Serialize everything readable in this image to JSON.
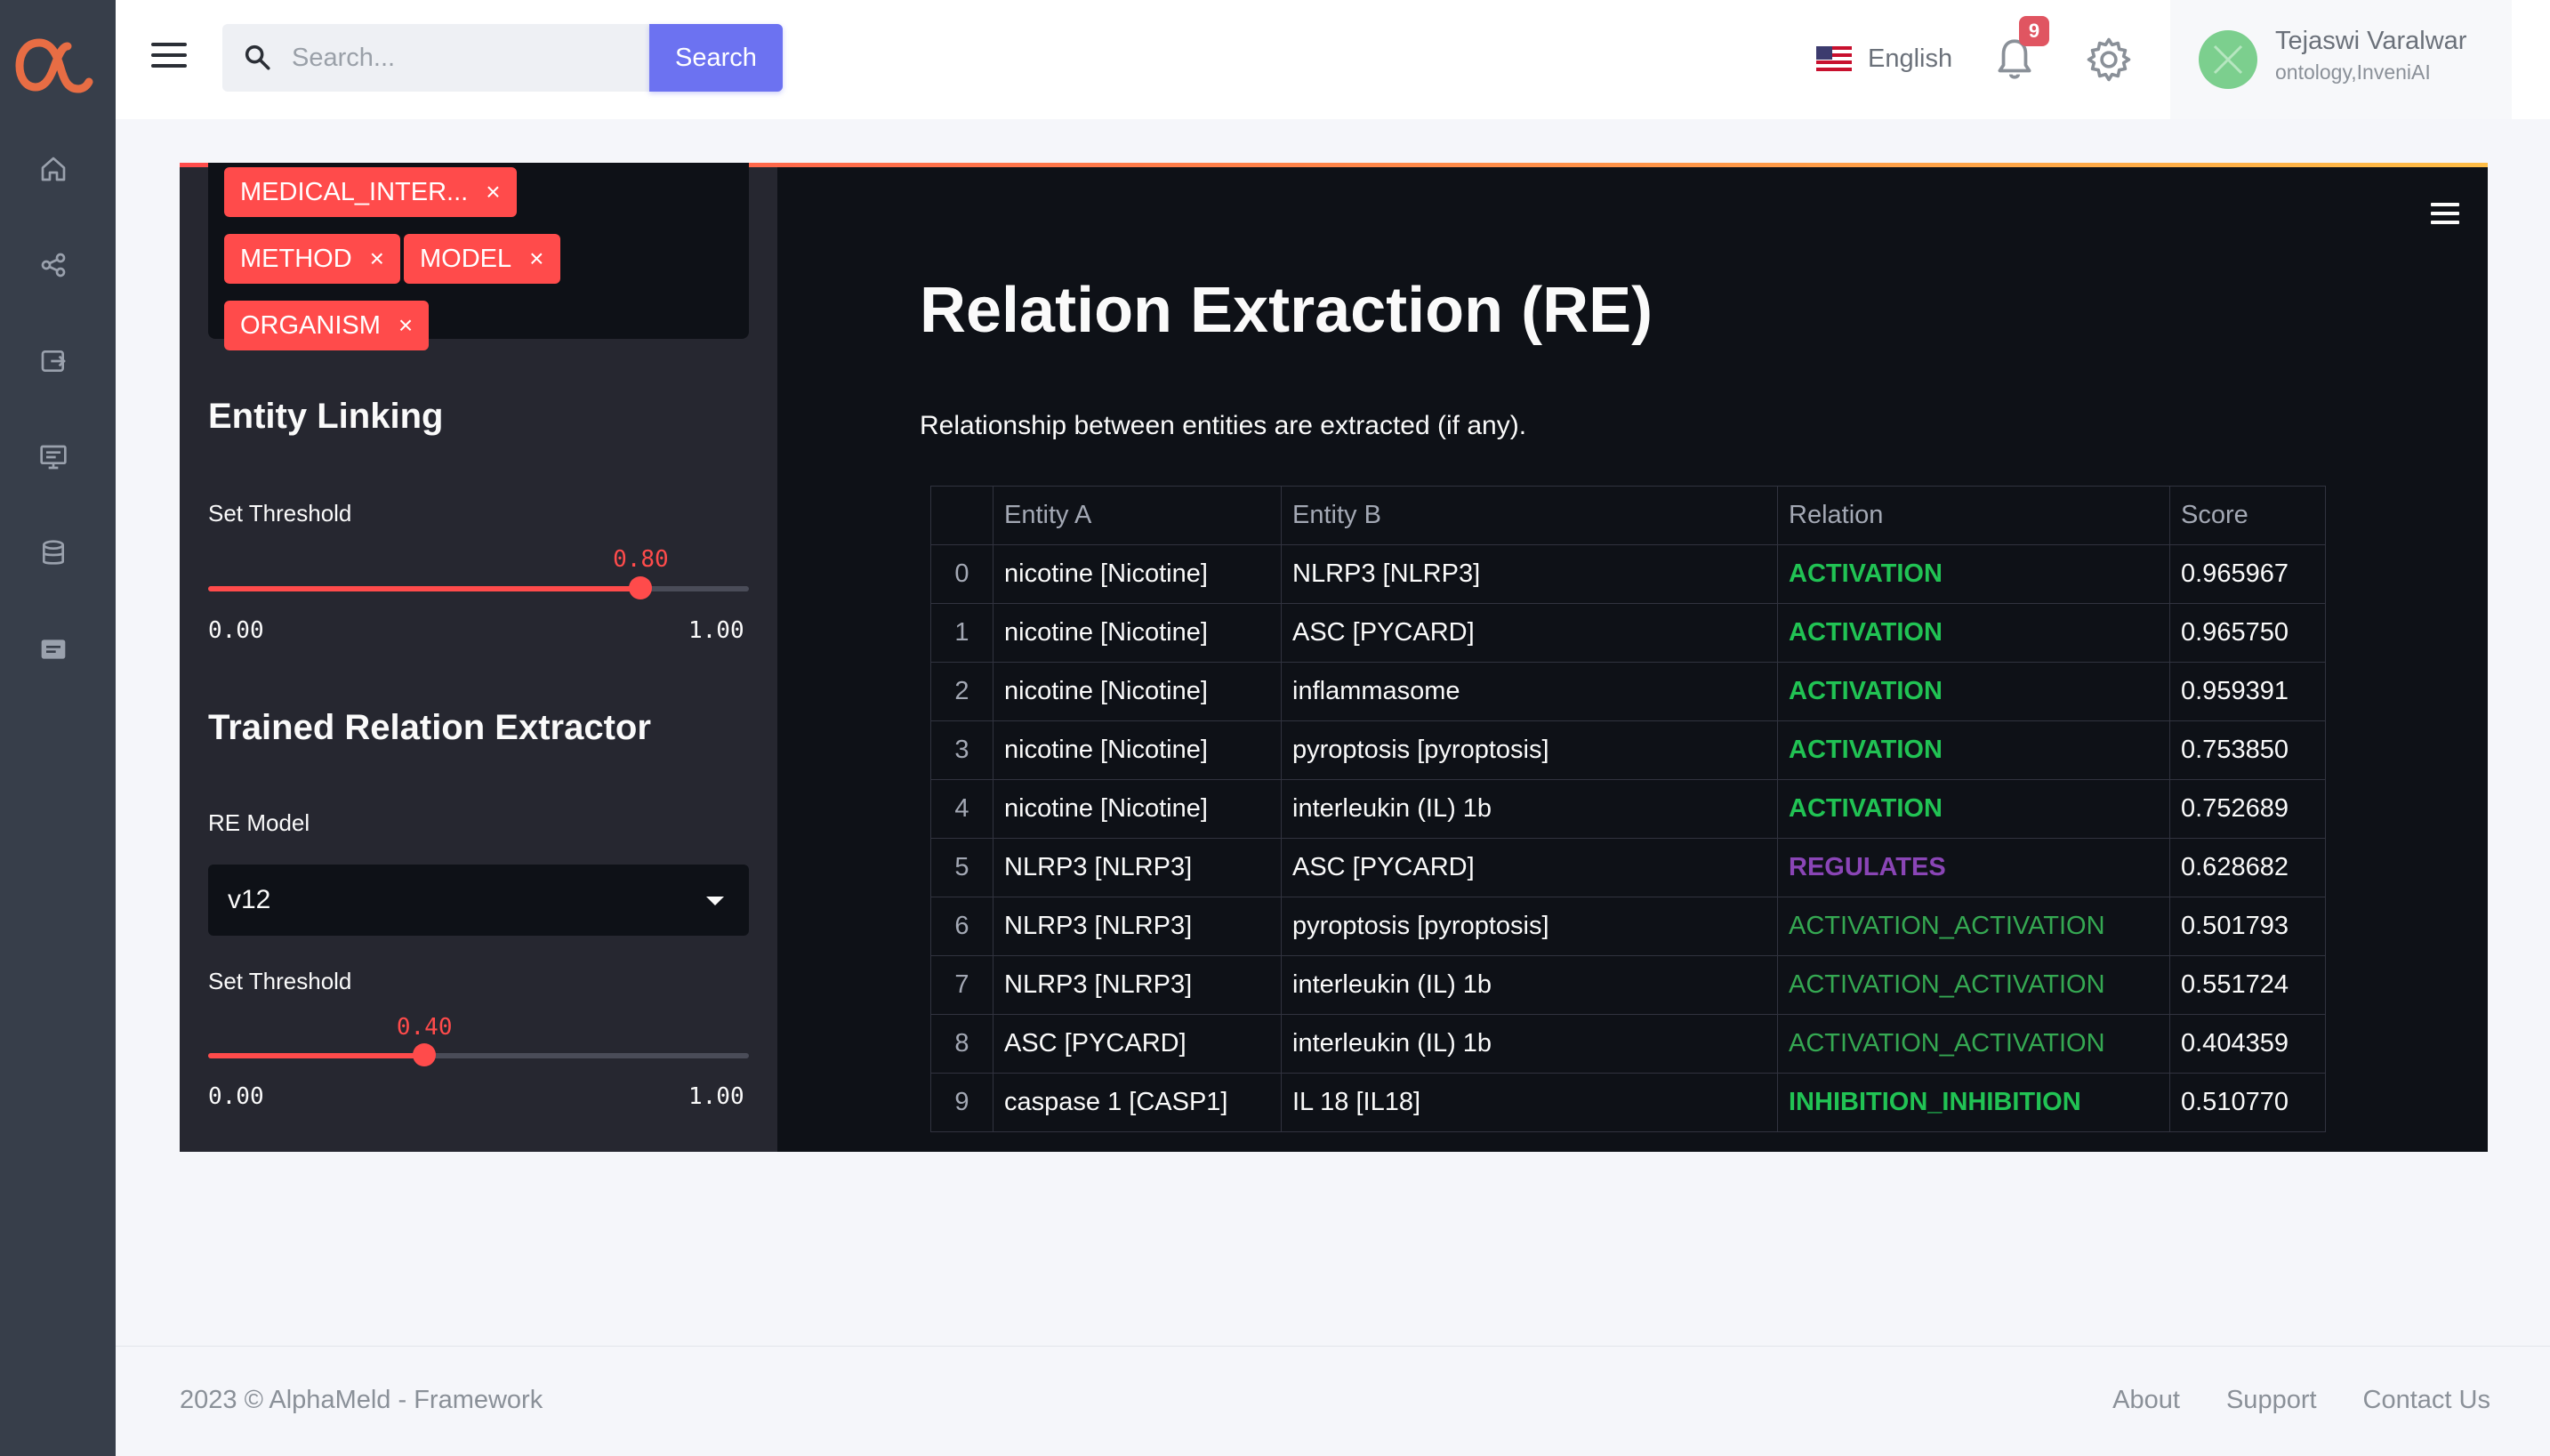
{
  "header": {
    "search_placeholder": "Search...",
    "search_button": "Search",
    "language": "English",
    "notification_count": "9",
    "user_name": "Tejaswi Varalwar",
    "user_org": "ontology,InveniAI"
  },
  "sidebar": {
    "logo": "α",
    "items": [
      "home-icon",
      "share-icon",
      "export-icon",
      "monitor-icon",
      "database-icon",
      "message-icon"
    ]
  },
  "left_panel": {
    "tags": [
      {
        "label": "MEDICAL_INTER...",
        "remove": "×"
      },
      {
        "label": "METHOD",
        "remove": "×"
      },
      {
        "label": "MODEL",
        "remove": "×"
      },
      {
        "label": "ORGANISM",
        "remove": "×"
      }
    ],
    "entity_linking": {
      "title": "Entity Linking",
      "threshold_label": "Set Threshold",
      "value": "0.80",
      "value_fraction": 0.8,
      "min": "0.00",
      "max": "1.00"
    },
    "relation_extractor": {
      "title": "Trained Relation Extractor",
      "model_label": "RE Model",
      "model_value": "v12",
      "threshold_label": "Set Threshold",
      "value": "0.40",
      "value_fraction": 0.4,
      "min": "0.00",
      "max": "1.00"
    }
  },
  "main": {
    "title": "Relation Extraction (RE)",
    "description": "Relationship between entities are extracted (if any).",
    "table": {
      "columns": [
        "",
        "Entity A",
        "Entity B",
        "Relation",
        "Score"
      ],
      "rows": [
        {
          "idx": "0",
          "a": "nicotine [Nicotine]",
          "b": "NLRP3 [NLRP3]",
          "rel": "ACTIVATION",
          "score": "0.965967",
          "color": "#21c354"
        },
        {
          "idx": "1",
          "a": "nicotine [Nicotine]",
          "b": "ASC [PYCARD]",
          "rel": "ACTIVATION",
          "score": "0.965750",
          "color": "#21c354"
        },
        {
          "idx": "2",
          "a": "nicotine [Nicotine]",
          "b": "inflammasome",
          "rel": "ACTIVATION",
          "score": "0.959391",
          "color": "#21c354"
        },
        {
          "idx": "3",
          "a": "nicotine [Nicotine]",
          "b": "pyroptosis [pyroptosis]",
          "rel": "ACTIVATION",
          "score": "0.753850",
          "color": "#21c354"
        },
        {
          "idx": "4",
          "a": "nicotine [Nicotine]",
          "b": "interleukin (IL) 1b",
          "rel": "ACTIVATION",
          "score": "0.752689",
          "color": "#21c354"
        },
        {
          "idx": "5",
          "a": "NLRP3 [NLRP3]",
          "b": "ASC [PYCARD]",
          "rel": "REGULATES",
          "score": "0.628682",
          "color": "#8a45b6"
        },
        {
          "idx": "6",
          "a": "NLRP3 [NLRP3]",
          "b": "pyroptosis [pyroptosis]",
          "rel": "ACTIVATION_ACTIVATION",
          "score": "0.501793",
          "color": "#35a852"
        },
        {
          "idx": "7",
          "a": "NLRP3 [NLRP3]",
          "b": "interleukin (IL) 1b",
          "rel": "ACTIVATION_ACTIVATION",
          "score": "0.551724",
          "color": "#35a852"
        },
        {
          "idx": "8",
          "a": "ASC [PYCARD]",
          "b": "interleukin (IL) 1b",
          "rel": "ACTIVATION_ACTIVATION",
          "score": "0.404359",
          "color": "#35a852"
        },
        {
          "idx": "9",
          "a": "caspase 1 [CASP1]",
          "b": "IL 18 [IL18]",
          "rel": "INHIBITION_INHIBITION",
          "score": "0.510770",
          "color": "#21c354"
        }
      ]
    }
  },
  "footer": {
    "copyright": "2023 © AlphaMeld - Framework",
    "links": [
      "About",
      "Support",
      "Contact Us"
    ]
  }
}
